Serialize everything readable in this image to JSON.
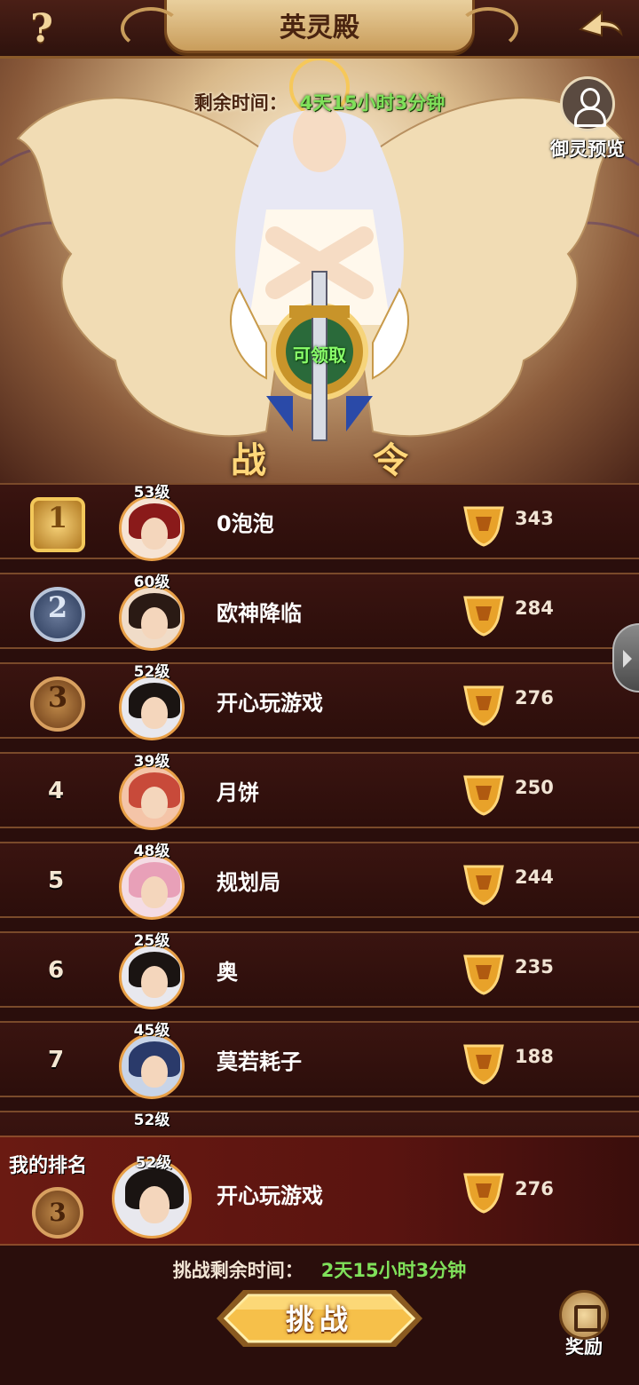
{
  "header": {
    "title": "英灵殿",
    "help_icon": "?"
  },
  "event": {
    "timer_label": "剩余时间：",
    "timer_value": "4天15小时3分钟",
    "preview_label": "御灵预览",
    "claim_label": "可领取",
    "pass_char_1": "战",
    "pass_char_2": "令"
  },
  "ranks": [
    {
      "rank": "1",
      "medal": "gold",
      "level": "53级",
      "name": "0泡泡",
      "score": "343",
      "hair": "#8a1a1a"
    },
    {
      "rank": "2",
      "medal": "silver",
      "level": "60级",
      "name": "欧神降临",
      "score": "284",
      "hair": "#2a1a14"
    },
    {
      "rank": "3",
      "medal": "bronze",
      "level": "52级",
      "name": "开心玩游戏",
      "score": "276",
      "hair": "#1a1412"
    },
    {
      "rank": "4",
      "medal": "",
      "level": "39级",
      "name": "月饼",
      "score": "250",
      "hair": "#c84a3a"
    },
    {
      "rank": "5",
      "medal": "",
      "level": "48级",
      "name": "规划局",
      "score": "244",
      "hair": "#e8a0b8"
    },
    {
      "rank": "6",
      "medal": "",
      "level": "25级",
      "name": "奥",
      "score": "235",
      "hair": "#1a1412"
    },
    {
      "rank": "7",
      "medal": "",
      "level": "45级",
      "name": "莫若耗子",
      "score": "188",
      "hair": "#2a3a6a"
    }
  ],
  "partial_row": {
    "level": "52级"
  },
  "my_rank": {
    "label": "我的排名",
    "rank": "3",
    "level": "52级",
    "name": "开心玩游戏",
    "score": "276"
  },
  "bottom": {
    "challenge_time_label": "挑战剩余时间：",
    "challenge_time_value": "2天15小时3分钟",
    "challenge_button": "挑战",
    "reward_label": "奖励"
  }
}
